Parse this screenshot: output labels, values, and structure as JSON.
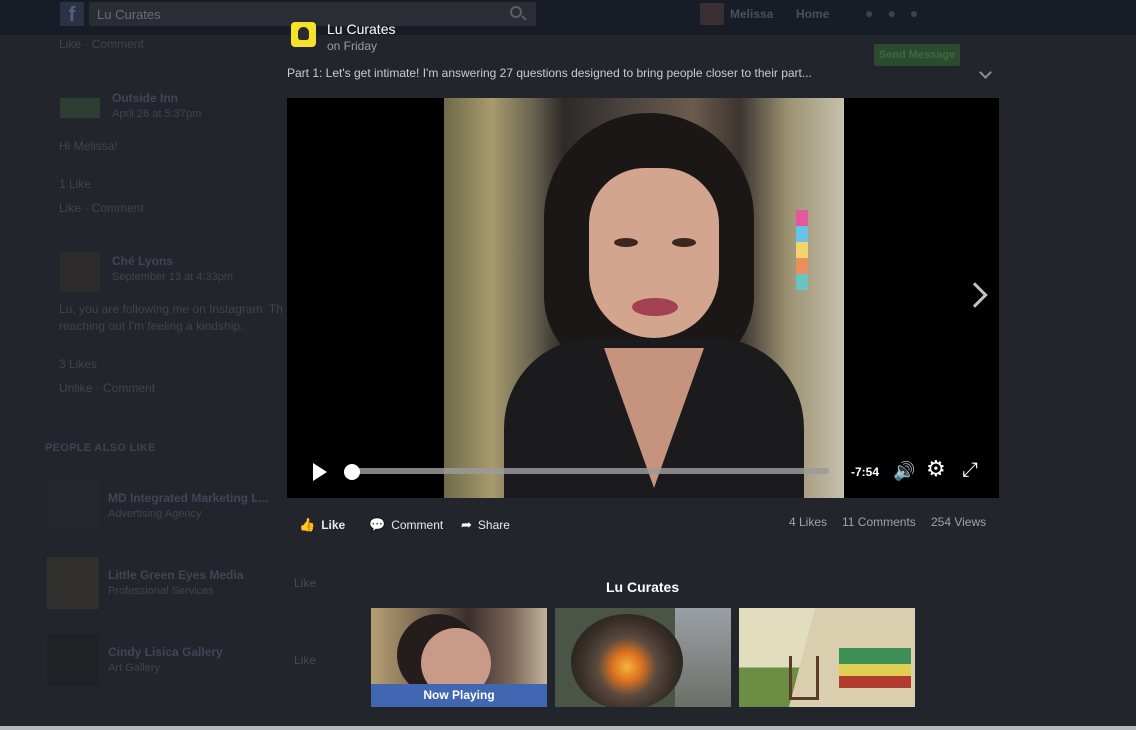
{
  "background": {
    "search_value": "Lu Curates",
    "user_name": "Melissa",
    "home_label": "Home",
    "like_comment_1": "Like · Comment",
    "post1_author": "Outside Inn",
    "post1_time": "April 26 at 5:37pm",
    "post1_text": "Hi Melissa!",
    "post1_likes": "1 Like",
    "post1_actions": "Like · Comment",
    "post2_author": "Ché Lyons",
    "post2_time": "September 13 at 4:33pm",
    "post2_text_1": "Lu, you are following me on Instagram. Th",
    "post2_text_2": "reaching out I'm feeling a kindship. ",
    "post2_likes": "3 Likes",
    "post2_actions": "Unlike · Comment",
    "people_also_like": "PEOPLE ALSO LIKE",
    "suggested": [
      {
        "name": "MD Integrated Marketing L...",
        "sub": "Advertising Agency"
      },
      {
        "name": "Little Green Eyes Media",
        "sub": "Professional Services"
      },
      {
        "name": "Cindy Lisica Gallery",
        "sub": "Art Gallery"
      }
    ],
    "like_label": "Like",
    "green_button": "Send Message"
  },
  "modal": {
    "page_name": "Lu Curates",
    "post_time": "on Friday",
    "caption": "Part 1: Let's get intimate! I'm answering 27 questions designed to bring people closer to their part...",
    "player": {
      "time_remaining": "-7:54",
      "progress": 0.0
    },
    "actions": {
      "like": "Like",
      "comment": "Comment",
      "share": "Share"
    },
    "stats": {
      "likes": "4 Likes",
      "comments": "11 Comments",
      "views": "254 Views"
    },
    "more_from": "Lu Curates",
    "now_playing": "Now Playing"
  },
  "colors": {
    "accent": "#4267b2",
    "overlay": "#22252b"
  }
}
